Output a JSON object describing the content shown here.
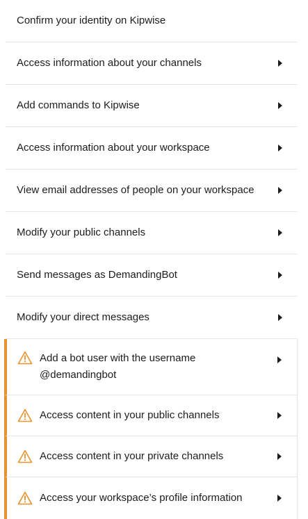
{
  "header": {
    "label": "Confirm your identity on Kipwise"
  },
  "permissions": [
    {
      "label": "Access information about your channels"
    },
    {
      "label": "Add commands to Kipwise"
    },
    {
      "label": "Access information about your workspace"
    },
    {
      "label": "View email addresses of people on your workspace"
    },
    {
      "label": "Modify your public channels"
    },
    {
      "label": "Send messages as DemandingBot"
    },
    {
      "label": "Modify your direct messages"
    }
  ],
  "warnings": [
    {
      "label_line1": "Add a bot user with the username",
      "label_line2": "@demandingbot"
    },
    {
      "label": "Access content in your public channels"
    },
    {
      "label": "Access content in your private channels"
    },
    {
      "label": "Access your workspace’s profile information"
    }
  ],
  "colors": {
    "warning_accent": "#e8912d",
    "text": "#1d1c1d",
    "divider": "#e6e6e6"
  },
  "icons": {
    "arrow": "caret-right-icon",
    "warning": "warning-triangle-icon"
  }
}
